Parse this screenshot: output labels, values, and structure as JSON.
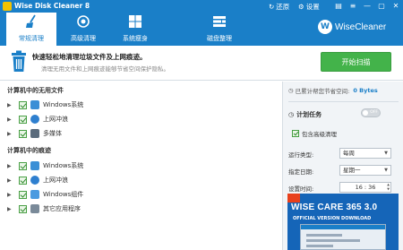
{
  "window": {
    "title": "Wise Disk Cleaner 8",
    "restore_label": "还原",
    "settings_label": "设置"
  },
  "nav": {
    "tabs": [
      {
        "label": "常规清理",
        "icon": "broom-icon",
        "active": true
      },
      {
        "label": "高级清理",
        "icon": "deep-scan-icon",
        "active": false
      },
      {
        "label": "系统瘦身",
        "icon": "windows-icon",
        "active": false
      },
      {
        "label": "磁盘整理",
        "icon": "defrag-icon",
        "active": false
      }
    ],
    "brand": "WiseCleaner"
  },
  "banner": {
    "headline": "快速轻松地清理垃圾文件及上网痕迹。",
    "subline": "清理无用文件和上网痕迹能够节省空间保护隐私。",
    "scan_button": "开始扫描"
  },
  "sections": [
    {
      "title": "计算机中的无用文件",
      "items": [
        "Windows系统",
        "上网冲浪",
        "多媒体"
      ]
    },
    {
      "title": "计算机中的痕迹",
      "items": [
        "Windows系统",
        "上网冲浪",
        "Windows组件",
        "其它应用程序"
      ]
    }
  ],
  "right": {
    "saved_label": "已累计帮您节省空间:",
    "saved_value": "0 Bytes",
    "schedule_label": "计划任务",
    "toggle_text": "OFF",
    "advanced_label": "包含高级清理",
    "run_type_label": "运行类型:",
    "run_type_value": "每周",
    "day_label": "指定日期:",
    "day_value": "星期一",
    "time_label": "设置时间:",
    "time_value": "16 : 36"
  },
  "ad": {
    "title": "WISE CARE 365 3.0",
    "subtitle": "OFFICIAL VERSION DOWNLOAD"
  },
  "colors": {
    "accent": "#1a7fc8",
    "scan_button": "#43b34a",
    "ad_background": "#1565b8"
  }
}
